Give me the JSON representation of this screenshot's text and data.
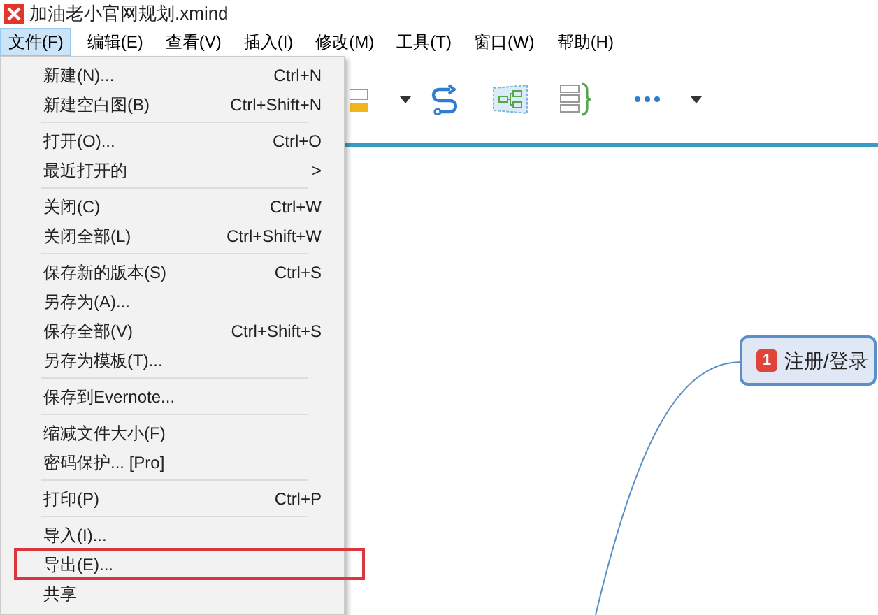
{
  "window": {
    "title": "加油老小官网规划.xmind"
  },
  "menubar": [
    {
      "label": "文件(F)",
      "selected": true
    },
    {
      "label": "编辑(E)",
      "selected": false
    },
    {
      "label": "查看(V)",
      "selected": false
    },
    {
      "label": "插入(I)",
      "selected": false
    },
    {
      "label": "修改(M)",
      "selected": false
    },
    {
      "label": "工具(T)",
      "selected": false
    },
    {
      "label": "窗口(W)",
      "selected": false
    },
    {
      "label": "帮助(H)",
      "selected": false
    }
  ],
  "file_menu": [
    {
      "kind": "item",
      "label": "新建(N)...",
      "shortcut": "Ctrl+N"
    },
    {
      "kind": "item",
      "label": "新建空白图(B)",
      "shortcut": "Ctrl+Shift+N"
    },
    {
      "kind": "separator"
    },
    {
      "kind": "item",
      "label": "打开(O)...",
      "shortcut": "Ctrl+O"
    },
    {
      "kind": "submenu",
      "label": "最近打开的",
      "shortcut": ">"
    },
    {
      "kind": "separator"
    },
    {
      "kind": "item",
      "label": "关闭(C)",
      "shortcut": "Ctrl+W"
    },
    {
      "kind": "item",
      "label": "关闭全部(L)",
      "shortcut": "Ctrl+Shift+W"
    },
    {
      "kind": "separator"
    },
    {
      "kind": "item",
      "label": "保存新的版本(S)",
      "shortcut": "Ctrl+S"
    },
    {
      "kind": "item",
      "label": "另存为(A)..."
    },
    {
      "kind": "item",
      "label": "保存全部(V)",
      "shortcut": "Ctrl+Shift+S"
    },
    {
      "kind": "item",
      "label": "另存为模板(T)..."
    },
    {
      "kind": "separator"
    },
    {
      "kind": "item",
      "label": "保存到Evernote..."
    },
    {
      "kind": "separator"
    },
    {
      "kind": "item",
      "label": "缩减文件大小(F)"
    },
    {
      "kind": "item",
      "label": "密码保护... [Pro]"
    },
    {
      "kind": "separator"
    },
    {
      "kind": "item",
      "label": "打印(P)",
      "shortcut": "Ctrl+P"
    },
    {
      "kind": "separator"
    },
    {
      "kind": "item",
      "label": "导入(I)..."
    },
    {
      "kind": "item",
      "label": "导出(E)...",
      "outlined": true
    },
    {
      "kind": "item",
      "label": "共享"
    }
  ],
  "canvas": {
    "topic": {
      "badge": "1",
      "label": "注册/登录"
    }
  }
}
